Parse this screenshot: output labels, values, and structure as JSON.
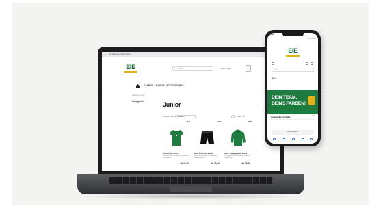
{
  "laptop_site": {
    "browser_tab_title": "Eie Teamsport Online-Shop",
    "logo_text": "EIE",
    "search_placeholder": "Suche",
    "account_text": "Mein Konto",
    "nav": [
      {
        "label": "DAMEN"
      },
      {
        "label": "JUNIOR"
      },
      {
        "label": "ACCESSOIRES"
      }
    ],
    "breadcrumb": "Startseite / Junior",
    "sidebar_title": "Kategorien",
    "page_heading": "Junior",
    "sort_label": "Sortieren nach",
    "sort_value": "Relevanz",
    "per_page": "Artikel: 24",
    "products": [
      {
        "badge": "NEW",
        "name": "JAKO Trikot Junior",
        "desc": "Kurzarm-Trikot für Kinder und Jugendliche, atmungsaktiv",
        "price": "ab 22,00",
        "color": "#1f7a3f",
        "kind": "shirt"
      },
      {
        "badge": "NEW",
        "name": "JAKO Sporthose Junior",
        "desc": "Sporthose für Kinder und Jugendliche, schnelltrocknend",
        "price": "ab 20,00",
        "color": "#111111",
        "kind": "shorts"
      },
      {
        "badge": "NEW",
        "name": "JAKO Trainingsjacke Junior",
        "desc": "Trainingsjacke mit Kapuze für Kinder und Jugendliche",
        "price": "ab 35,00",
        "color": "#1f7a3f",
        "kind": "hoodie"
      }
    ]
  },
  "phone_site": {
    "status_time": "9:41",
    "top_text": "Mein Konto",
    "logo_text": "EIE",
    "search_placeholder": "Suche",
    "menu_text": "Menü",
    "banner_line1": "DEIN TEAM,",
    "banner_line2": "DEINE FARBEN!",
    "section_title": "Vorgestellte Produkte",
    "section_link": "Alle",
    "url": "eie-teamsport.de"
  },
  "colors": {
    "brand_green": "#1f7a3f",
    "brand_gold": "#e0b21b"
  }
}
